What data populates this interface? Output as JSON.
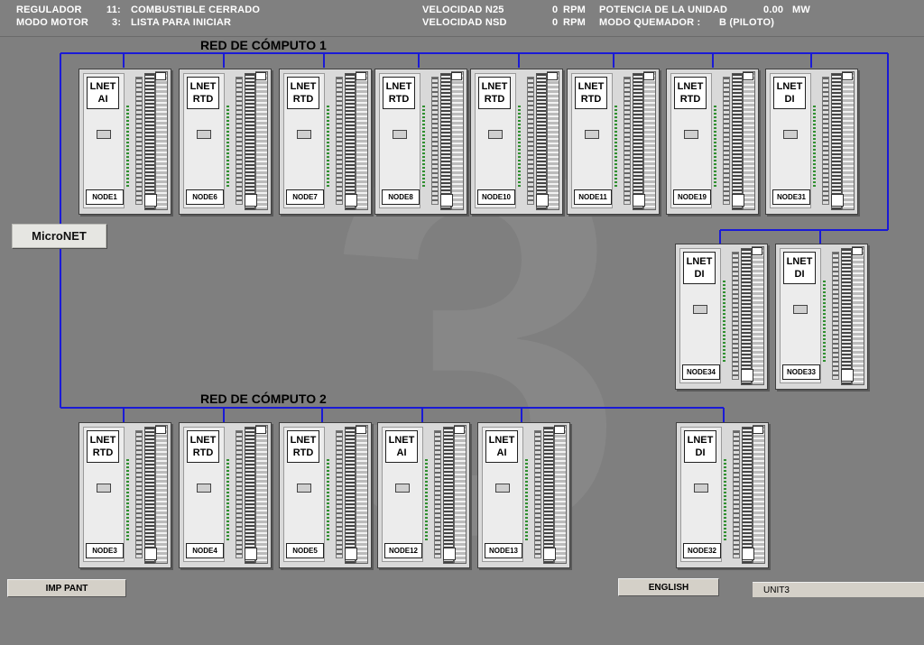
{
  "header": {
    "regulador_label": "REGULADOR",
    "regulador_code": "11:",
    "regulador_value": "COMBUSTIBLE CERRADO",
    "modo_motor_label": "MODO MOTOR",
    "modo_motor_code": "3:",
    "modo_motor_value": "LISTA PARA INICIAR",
    "vel_n25_label": "VELOCIDAD N25",
    "vel_n25_value": "0",
    "vel_n25_unit": "RPM",
    "vel_nsd_label": "VELOCIDAD NSD",
    "vel_nsd_value": "0",
    "vel_nsd_unit": "RPM",
    "potencia_label": "POTENCIA DE LA UNIDAD",
    "potencia_value": "0.00",
    "potencia_unit": "MW",
    "quemador_label": "MODO QUEMADOR :",
    "quemador_value": "B (PILOTO)"
  },
  "watermark": "3",
  "network1": {
    "label": "RED DE CÓMPUTO 1"
  },
  "network2": {
    "label": "RED DE CÓMPUTO 2"
  },
  "micronet": {
    "label": "MicroNET"
  },
  "modules_top": [
    {
      "line1": "LNET",
      "line2": "AI",
      "node": "NODE1"
    },
    {
      "line1": "LNET",
      "line2": "RTD",
      "node": "NODE6"
    },
    {
      "line1": "LNET",
      "line2": "RTD",
      "node": "NODE7"
    },
    {
      "line1": "LNET",
      "line2": "RTD",
      "node": "NODE8"
    },
    {
      "line1": "LNET",
      "line2": "RTD",
      "node": "NODE10"
    },
    {
      "line1": "LNET",
      "line2": "RTD",
      "node": "NODE11"
    },
    {
      "line1": "LNET",
      "line2": "RTD",
      "node": "NODE19"
    },
    {
      "line1": "LNET",
      "line2": "DI",
      "node": "NODE31"
    }
  ],
  "modules_mid": [
    {
      "line1": "LNET",
      "line2": "DI",
      "node": "NODE34"
    },
    {
      "line1": "LNET",
      "line2": "DI",
      "node": "NODE33"
    }
  ],
  "modules_bottom": [
    {
      "line1": "LNET",
      "line2": "RTD",
      "node": "NODE3"
    },
    {
      "line1": "LNET",
      "line2": "RTD",
      "node": "NODE4"
    },
    {
      "line1": "LNET",
      "line2": "RTD",
      "node": "NODE5"
    },
    {
      "line1": "LNET",
      "line2": "AI",
      "node": "NODE12"
    },
    {
      "line1": "LNET",
      "line2": "AI",
      "node": "NODE13"
    },
    {
      "line1": "LNET",
      "line2": "DI",
      "node": "NODE32"
    }
  ],
  "footer": {
    "print_button": "IMP PANT",
    "language_button": "ENGLISH",
    "unit": "UNIT3"
  },
  "colors": {
    "background": "#7f7f7f",
    "network_line": "#1a1ad6",
    "text_header": "#ffffff"
  }
}
